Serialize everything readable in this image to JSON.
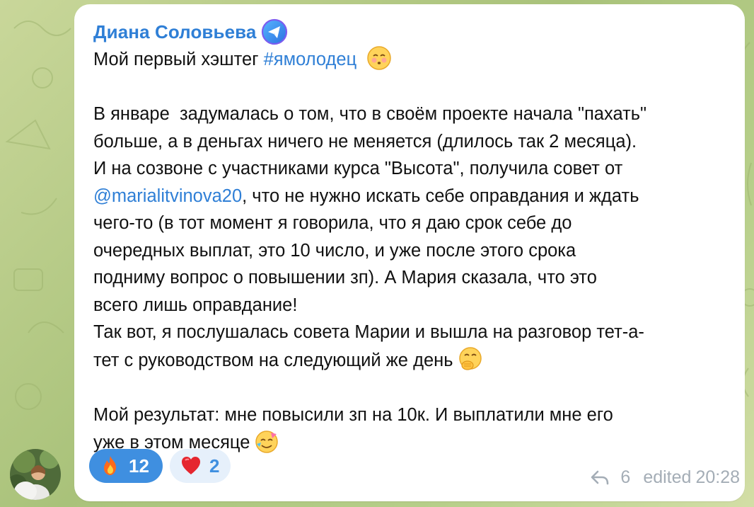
{
  "message": {
    "sender": "Диана Соловьева",
    "lines": [
      "Мой первый хэштег ",
      "#ямолодец",
      "В январе  задумалась о том, что в своём проекте начала \"пахать\"",
      "больше, а в деньгах ничего не меняется (длилось так 2 месяца).",
      "И на созвоне с участниками курса \"Высота\", получила совет от",
      "@marialitvinova20",
      ", что не нужно искать себе оправдания и ждать",
      "чего-то (в тот момент я говорила, что я даю срок себе до",
      "очередных выплат, это 10 число, и уже после этого срока",
      "подниму вопрос о повышении зп). А Мария сказала, что это",
      "всего лишь оправдание!",
      "Так вот, я послушалась совета Марии и вышла на разговор тет-а-",
      "тет с руководством на следующий же день",
      "Мой результат: мне повысили зп на 10к. И выплатили мне его",
      "уже в этом месяце"
    ]
  },
  "reactions": [
    {
      "emoji": "fire-icon",
      "count": "12",
      "active": true
    },
    {
      "emoji": "heart-icon",
      "count": "2",
      "active": false
    }
  ],
  "meta": {
    "replies": "6",
    "edited_label": "edited",
    "time": "20:28"
  },
  "colors": {
    "link": "#2f7fd6",
    "reaction_active_bg": "#3f8fe0",
    "reaction_inactive_bg": "#e6f0fb",
    "meta_text": "#a4adb6"
  }
}
